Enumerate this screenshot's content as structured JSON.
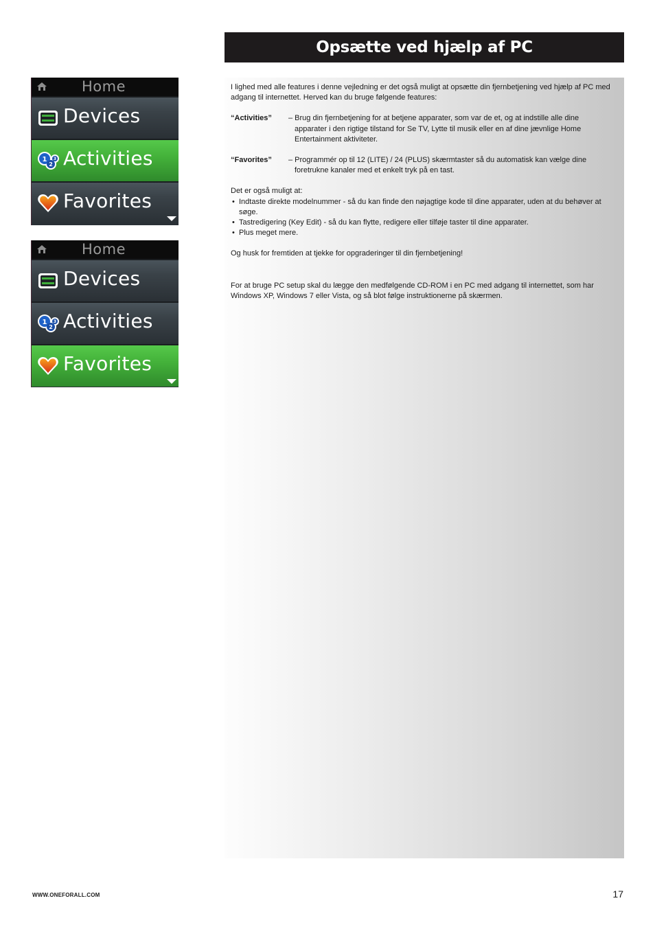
{
  "page": {
    "title": "Opsætte ved hjælp af PC",
    "footer_url": "WWW.ONEFORALL.COM",
    "page_number": "17"
  },
  "screens": [
    {
      "header": {
        "icon": "home-icon",
        "title": "Home"
      },
      "items": [
        {
          "label": "Devices",
          "icon": "devices-icon",
          "active": false
        },
        {
          "label": "Activities",
          "icon": "activities-icon",
          "active": true
        },
        {
          "label": "Favorites",
          "icon": "favorites-heart-icon",
          "active": false
        }
      ],
      "more_indicator": "down-arrow-icon"
    },
    {
      "header": {
        "icon": "home-icon",
        "title": "Home"
      },
      "items": [
        {
          "label": "Devices",
          "icon": "devices-icon",
          "active": false
        },
        {
          "label": "Activities",
          "icon": "activities-icon",
          "active": false
        },
        {
          "label": "Favorites",
          "icon": "favorites-heart-icon",
          "active": true
        }
      ],
      "more_indicator": "down-arrow-icon"
    }
  ],
  "content": {
    "intro": "I lighed med alle features i denne vejledning er det også muligt at opsætte din fjernbetjening ved hjælp af PC med adgang til internettet. Herved kan du bruge følgende features:",
    "features": [
      {
        "term": "“Activities”",
        "description": "– Brug din fjernbetjening for at betjene apparater, som var de et, og at indstille alle dine apparater i den rigtige tilstand for Se TV, Lytte til musik eller en af dine jævnlige Home Entertainment aktiviteter."
      },
      {
        "term": "“Favorites”",
        "description": "– Programmér op til 12 (LITE) / 24 (PLUS) skærmtaster så du automatisk kan vælge dine foretrukne kanaler med et enkelt tryk på en tast."
      }
    ],
    "also_heading": "Det er også muligt at:",
    "bullets": [
      "Indtaste direkte modelnummer - så du kan finde den nøjagtige kode til dine apparater, uden at du behøver at søge.",
      "Tastredigering (Key Edit) - så du kan flytte, redigere eller tilføje taster til dine apparater.",
      "Plus meget mere."
    ],
    "bullet_char": "•",
    "reminder": "Og husk for fremtiden at tjekke for opgraderinger til din fjernbetjening!",
    "pc_setup": "For at bruge PC setup skal du lægge den medfølgende CD-ROM i en PC med adgang til internettet, som har Windows XP, Windows 7 eller Vista, og så blot følge instruktionerne på skærmen."
  }
}
